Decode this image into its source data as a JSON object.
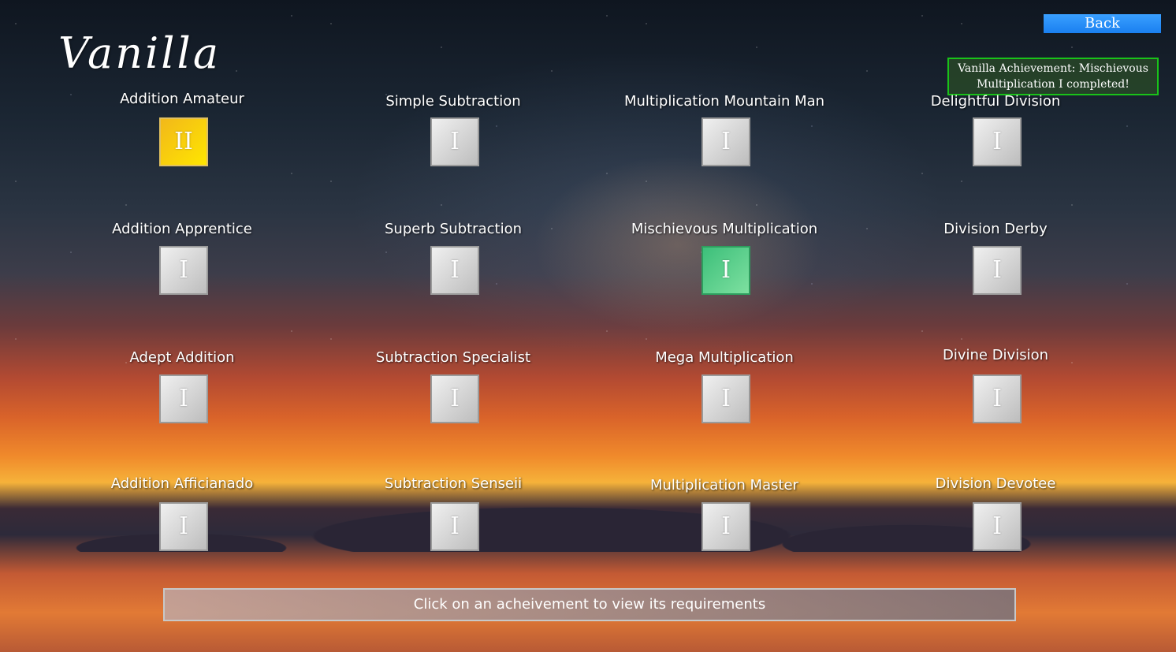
{
  "header": {
    "title": "Vanilla",
    "back_label": "Back"
  },
  "notification": {
    "text": "Vanilla Achievement: Mischievous Multiplication I completed!"
  },
  "achievements": [
    {
      "label": "Addition Amateur",
      "tier": "II",
      "state": "gold"
    },
    {
      "label": "Simple Subtraction",
      "tier": "I",
      "state": "default"
    },
    {
      "label": "Multiplication Mountain Man",
      "tier": "I",
      "state": "default"
    },
    {
      "label": "Delightful Division",
      "tier": "I",
      "state": "default"
    },
    {
      "label": "Addition Apprentice",
      "tier": "I",
      "state": "default"
    },
    {
      "label": "Superb Subtraction",
      "tier": "I",
      "state": "default"
    },
    {
      "label": "Mischievous Multiplication",
      "tier": "I",
      "state": "green"
    },
    {
      "label": "Division Derby",
      "tier": "I",
      "state": "default"
    },
    {
      "label": "Adept Addition",
      "tier": "I",
      "state": "default"
    },
    {
      "label": "Subtraction Specialist",
      "tier": "I",
      "state": "default"
    },
    {
      "label": "Mega Multiplication",
      "tier": "I",
      "state": "default"
    },
    {
      "label": "Divine Division",
      "tier": "I",
      "state": "default"
    },
    {
      "label": "Addition Afficianado",
      "tier": "I",
      "state": "default"
    },
    {
      "label": "Subtraction Senseii",
      "tier": "I",
      "state": "default"
    },
    {
      "label": "Multiplication Master",
      "tier": "I",
      "state": "default"
    },
    {
      "label": "Division Devotee",
      "tier": "I",
      "state": "default"
    }
  ],
  "footer": {
    "hint": "Click on an acheivement to view its requirements"
  },
  "colors": {
    "gold": "#ffd400",
    "green": "#4fcf86",
    "accent": "#1a7ff0",
    "toast_border": "#19c219"
  }
}
